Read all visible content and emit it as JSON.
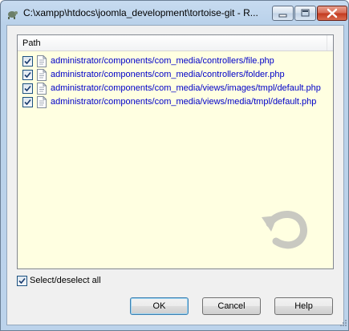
{
  "window": {
    "title": "C:\\xampp\\htdocs\\joomla_development\\tortoise-git - R..."
  },
  "list": {
    "column_header": "Path",
    "items": [
      {
        "path": "administrator/components/com_media/controllers/file.php",
        "checked": true
      },
      {
        "path": "administrator/components/com_media/controllers/folder.php",
        "checked": true
      },
      {
        "path": "administrator/components/com_media/views/images/tmpl/default.php",
        "checked": true
      },
      {
        "path": "administrator/components/com_media/views/media/tmpl/default.php",
        "checked": true
      }
    ]
  },
  "select_all": {
    "label": "Select/deselect all",
    "checked": true
  },
  "buttons": {
    "ok": "OK",
    "cancel": "Cancel",
    "help": "Help"
  },
  "icons": {
    "app": "tortoisegit-icon",
    "file": "php-file-icon",
    "watermark": "revert-arrow-icon"
  },
  "colors": {
    "list_background": "#ffffe1",
    "item_text": "#0000c8",
    "close_button": "#c2391e"
  }
}
